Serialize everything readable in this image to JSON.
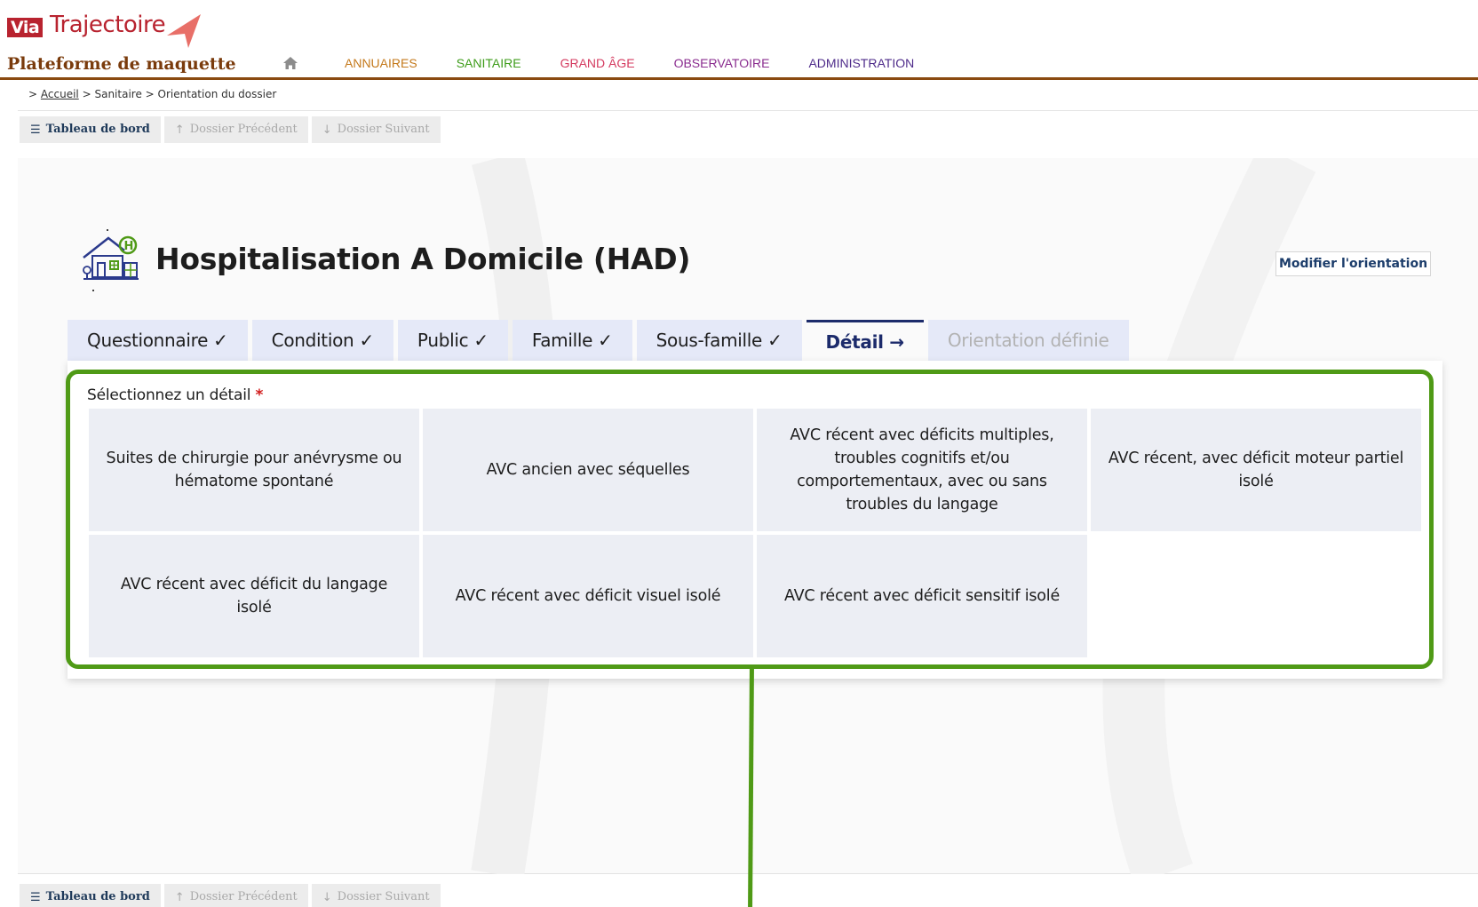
{
  "logo": {
    "via": "Via",
    "trajectoire": "Trajectoire"
  },
  "platform_name": "Plateforme de maquette",
  "nav": {
    "home_icon": "home-icon",
    "items": [
      "ANNUAIRES",
      "SANITAIRE",
      "GRAND ÂGE",
      "OBSERVATOIRE",
      "ADMINISTRATION"
    ]
  },
  "breadcrumb": {
    "prefix": ">",
    "home": "Accueil",
    "sep": ">",
    "section": "Sanitaire",
    "page": "Orientation du dossier"
  },
  "toolbar": {
    "dashboard": "Tableau de bord",
    "previous": "Dossier Précédent",
    "next": "Dossier Suivant"
  },
  "page": {
    "title": "Hospitalisation A Domicile (HAD)",
    "modify_button": "Modifier l'orientation"
  },
  "tabs": [
    {
      "label": "Questionnaire ✓",
      "state": "done"
    },
    {
      "label": "Condition ✓",
      "state": "done"
    },
    {
      "label": "Public ✓",
      "state": "done"
    },
    {
      "label": "Famille ✓",
      "state": "done"
    },
    {
      "label": "Sous-famille ✓",
      "state": "done"
    },
    {
      "label": "Détail →",
      "state": "active"
    },
    {
      "label": "Orientation définie",
      "state": "pending"
    }
  ],
  "detail": {
    "label": "Sélectionnez un détail",
    "required_mark": "*",
    "options": [
      "Suites de chirurgie pour anévrysme ou hématome spontané",
      "AVC ancien avec séquelles",
      "AVC récent avec déficits multiples, troubles cognitifs et/ou comportementaux, avec ou sans troubles du langage",
      "AVC récent, avec déficit moteur partiel isolé",
      "AVC récent avec déficit du langage isolé",
      "AVC récent avec déficit visuel isolé",
      "AVC récent avec déficit sensitif isolé"
    ]
  },
  "colors": {
    "brand_red": "#b8232f",
    "header_rule": "#8a4a10",
    "active_tab": "#1c2b6b",
    "tab_bg": "#e5e9f8",
    "highlight_green": "#4f9a16"
  }
}
